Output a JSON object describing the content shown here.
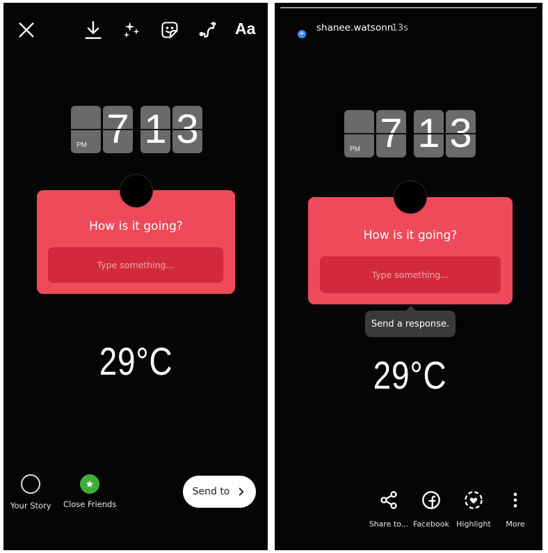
{
  "left_panel": {
    "toolbar": {
      "close": "close-icon",
      "download": "download-icon",
      "effects": "sparkles-icon",
      "sticker": "sticker-icon",
      "draw": "draw-icon",
      "text_label": "Aa"
    },
    "clock": {
      "ampm": "PM",
      "hour": "7",
      "minute_tens": "1",
      "minute_ones": "3"
    },
    "question": {
      "title": "How is it going?",
      "placeholder": "Type something..."
    },
    "temperature": "29°C",
    "share_options": [
      {
        "label": "Your Story",
        "icon": "circle-icon"
      },
      {
        "label": "Close Friends",
        "icon": "star-icon",
        "color": "#3fad3a"
      }
    ],
    "send_button": {
      "label": "Send to",
      "icon": "chevron-right-icon"
    }
  },
  "right_panel": {
    "header": {
      "username": "shanee.watsonn",
      "time_ago": "13s",
      "add_icon": "plus-icon"
    },
    "clock": {
      "ampm": "PM",
      "hour": "7",
      "minute_tens": "1",
      "minute_ones": "3"
    },
    "question": {
      "title": "How is it going?",
      "placeholder": "Type something..."
    },
    "tooltip": "Send a response.",
    "temperature": "29°C",
    "actions": [
      {
        "label": "Share to...",
        "icon": "share-icon"
      },
      {
        "label": "Facebook",
        "icon": "facebook-icon"
      },
      {
        "label": "Highlight",
        "icon": "highlight-icon"
      },
      {
        "label": "More",
        "icon": "more-vertical-icon"
      }
    ]
  },
  "colors": {
    "sticker": "#ee4a5a",
    "sticker_input": "#d22a3c",
    "close_friends": "#3fad3a",
    "badge_blue": "#2f8cf0"
  }
}
